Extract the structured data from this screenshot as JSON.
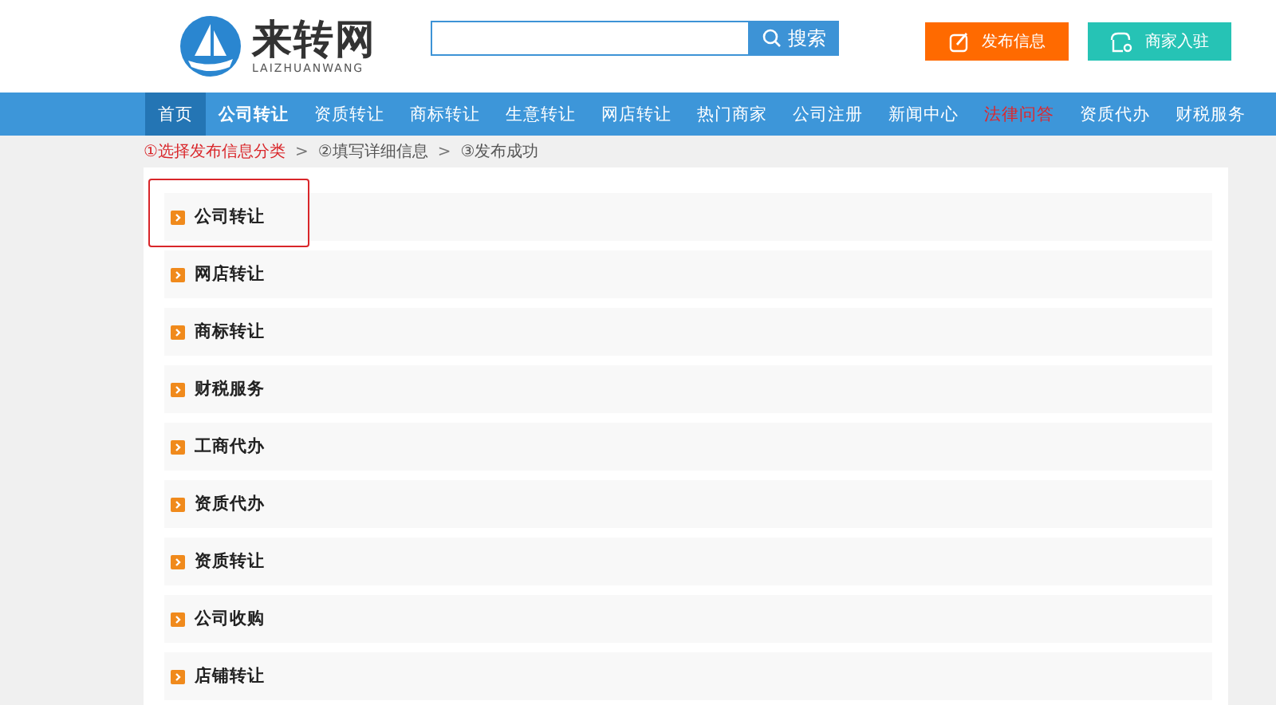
{
  "logo": {
    "name": "来转网",
    "subtitle": "LAIZHUANWANG"
  },
  "search": {
    "button": "搜索"
  },
  "actions": [
    {
      "kind": "publish",
      "label": "发布信息"
    },
    {
      "kind": "merchant",
      "label": "商家入驻"
    }
  ],
  "nav": [
    {
      "label": "首页",
      "selected": true,
      "bold": false,
      "highlight": false
    },
    {
      "label": "公司转让",
      "selected": false,
      "bold": true,
      "highlight": false
    },
    {
      "label": "资质转让",
      "selected": false,
      "bold": false,
      "highlight": false
    },
    {
      "label": "商标转让",
      "selected": false,
      "bold": false,
      "highlight": false
    },
    {
      "label": "生意转让",
      "selected": false,
      "bold": false,
      "highlight": false
    },
    {
      "label": "网店转让",
      "selected": false,
      "bold": false,
      "highlight": false
    },
    {
      "label": "热门商家",
      "selected": false,
      "bold": false,
      "highlight": false
    },
    {
      "label": "公司注册",
      "selected": false,
      "bold": false,
      "highlight": false
    },
    {
      "label": "新闻中心",
      "selected": false,
      "bold": false,
      "highlight": false
    },
    {
      "label": "法律问答",
      "selected": false,
      "bold": false,
      "highlight": true
    },
    {
      "label": "资质代办",
      "selected": false,
      "bold": false,
      "highlight": false
    },
    {
      "label": "财税服务",
      "selected": false,
      "bold": false,
      "highlight": false
    }
  ],
  "steps": [
    {
      "label": "①选择发布信息分类",
      "current": true,
      "separator": ">"
    },
    {
      "label": "②填写详细信息",
      "current": false,
      "separator": ">"
    },
    {
      "label": "③发布成功",
      "current": false
    }
  ],
  "categories": [
    {
      "label": "公司转让",
      "selected": true
    },
    {
      "label": "网店转让",
      "selected": false
    },
    {
      "label": "商标转让",
      "selected": false
    },
    {
      "label": "财税服务",
      "selected": false
    },
    {
      "label": "工商代办",
      "selected": false
    },
    {
      "label": "资质代办",
      "selected": false
    },
    {
      "label": "资质转让",
      "selected": false
    },
    {
      "label": "公司收购",
      "selected": false
    },
    {
      "label": "店铺转让",
      "selected": false
    }
  ]
}
